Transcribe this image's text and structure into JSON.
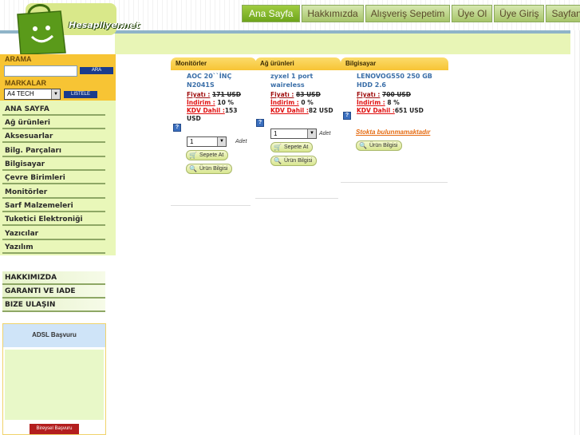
{
  "logo": {
    "text": "Hesapliyer.net"
  },
  "nav": [
    {
      "label": "Ana Sayfa",
      "active": true
    },
    {
      "label": "Hakkımızda"
    },
    {
      "label": "Alışveriş Sepetim"
    },
    {
      "label": "Üye Ol"
    },
    {
      "label": "Üye Giriş"
    },
    {
      "label": "Sayfanız"
    }
  ],
  "sidebar": {
    "search_title": "ARAMA",
    "search_button": "ARA",
    "brands_title": "MARKALAR",
    "brand_selected": "A4 TECH",
    "list_button": "LISTELE",
    "categories": [
      "ANA SAYFA",
      "Ağ ürünleri",
      "Aksesuarlar",
      "Bilg. Parçaları",
      "Bilgisayar",
      "Çevre Birimleri",
      "Monitörler",
      "Sarf Malzemeleri",
      "Tuketici Elektroniği",
      "Yazıcılar",
      "Yazılım"
    ],
    "info_links": [
      "HAKKIMIZDA",
      "GARANTI VE IADE",
      "BIZE ULAŞIN"
    ],
    "adsl_title": "ADSL Başvuru",
    "adsl_button": "Bireysel Başvuru"
  },
  "products": [
    {
      "category": "Monitörler",
      "name": "AOC 20``İNÇ N2041S",
      "price_label": "Fiyatı :",
      "price": "171 USD",
      "discount_label": "İndirim :",
      "discount": "10 %",
      "kdv_label": "KDV Dahil :",
      "kdv": "153 USD",
      "qty": "1",
      "adet": "Adet",
      "cart_btn": "Sepete At",
      "info_btn": "Ürün Bilgisi"
    },
    {
      "category": "Ağ ürünleri",
      "name": "zyxel 1 port waireless",
      "price_label": "Fiyatı :",
      "price": "83 USD",
      "discount_label": "İndirim :",
      "discount": "0 %",
      "kdv_label": "KDV Dahil :",
      "kdv": "82 USD",
      "qty": "1",
      "adet": "Adet",
      "cart_btn": "Sepete At",
      "info_btn": "Ürün Bilgisi"
    },
    {
      "category": "Bilgisayar",
      "name": "LENOVOG550 250 GB HDD 2.6",
      "price_label": "Fiyatı :",
      "price": "700 USD",
      "discount_label": "İndirim :",
      "discount": "8 %",
      "kdv_label": "KDV Dahil :",
      "kdv": "651 USD",
      "stock": "Stokta bulunmamaktadır",
      "info_btn": "Ürün Bilgisi"
    }
  ],
  "colors": {
    "brand_green": "#6ea51c",
    "side_yellow": "#f7c434",
    "menu_bg": "#e9f7b9",
    "link_blue": "#3b6fa8",
    "price_red": "#a01010"
  }
}
